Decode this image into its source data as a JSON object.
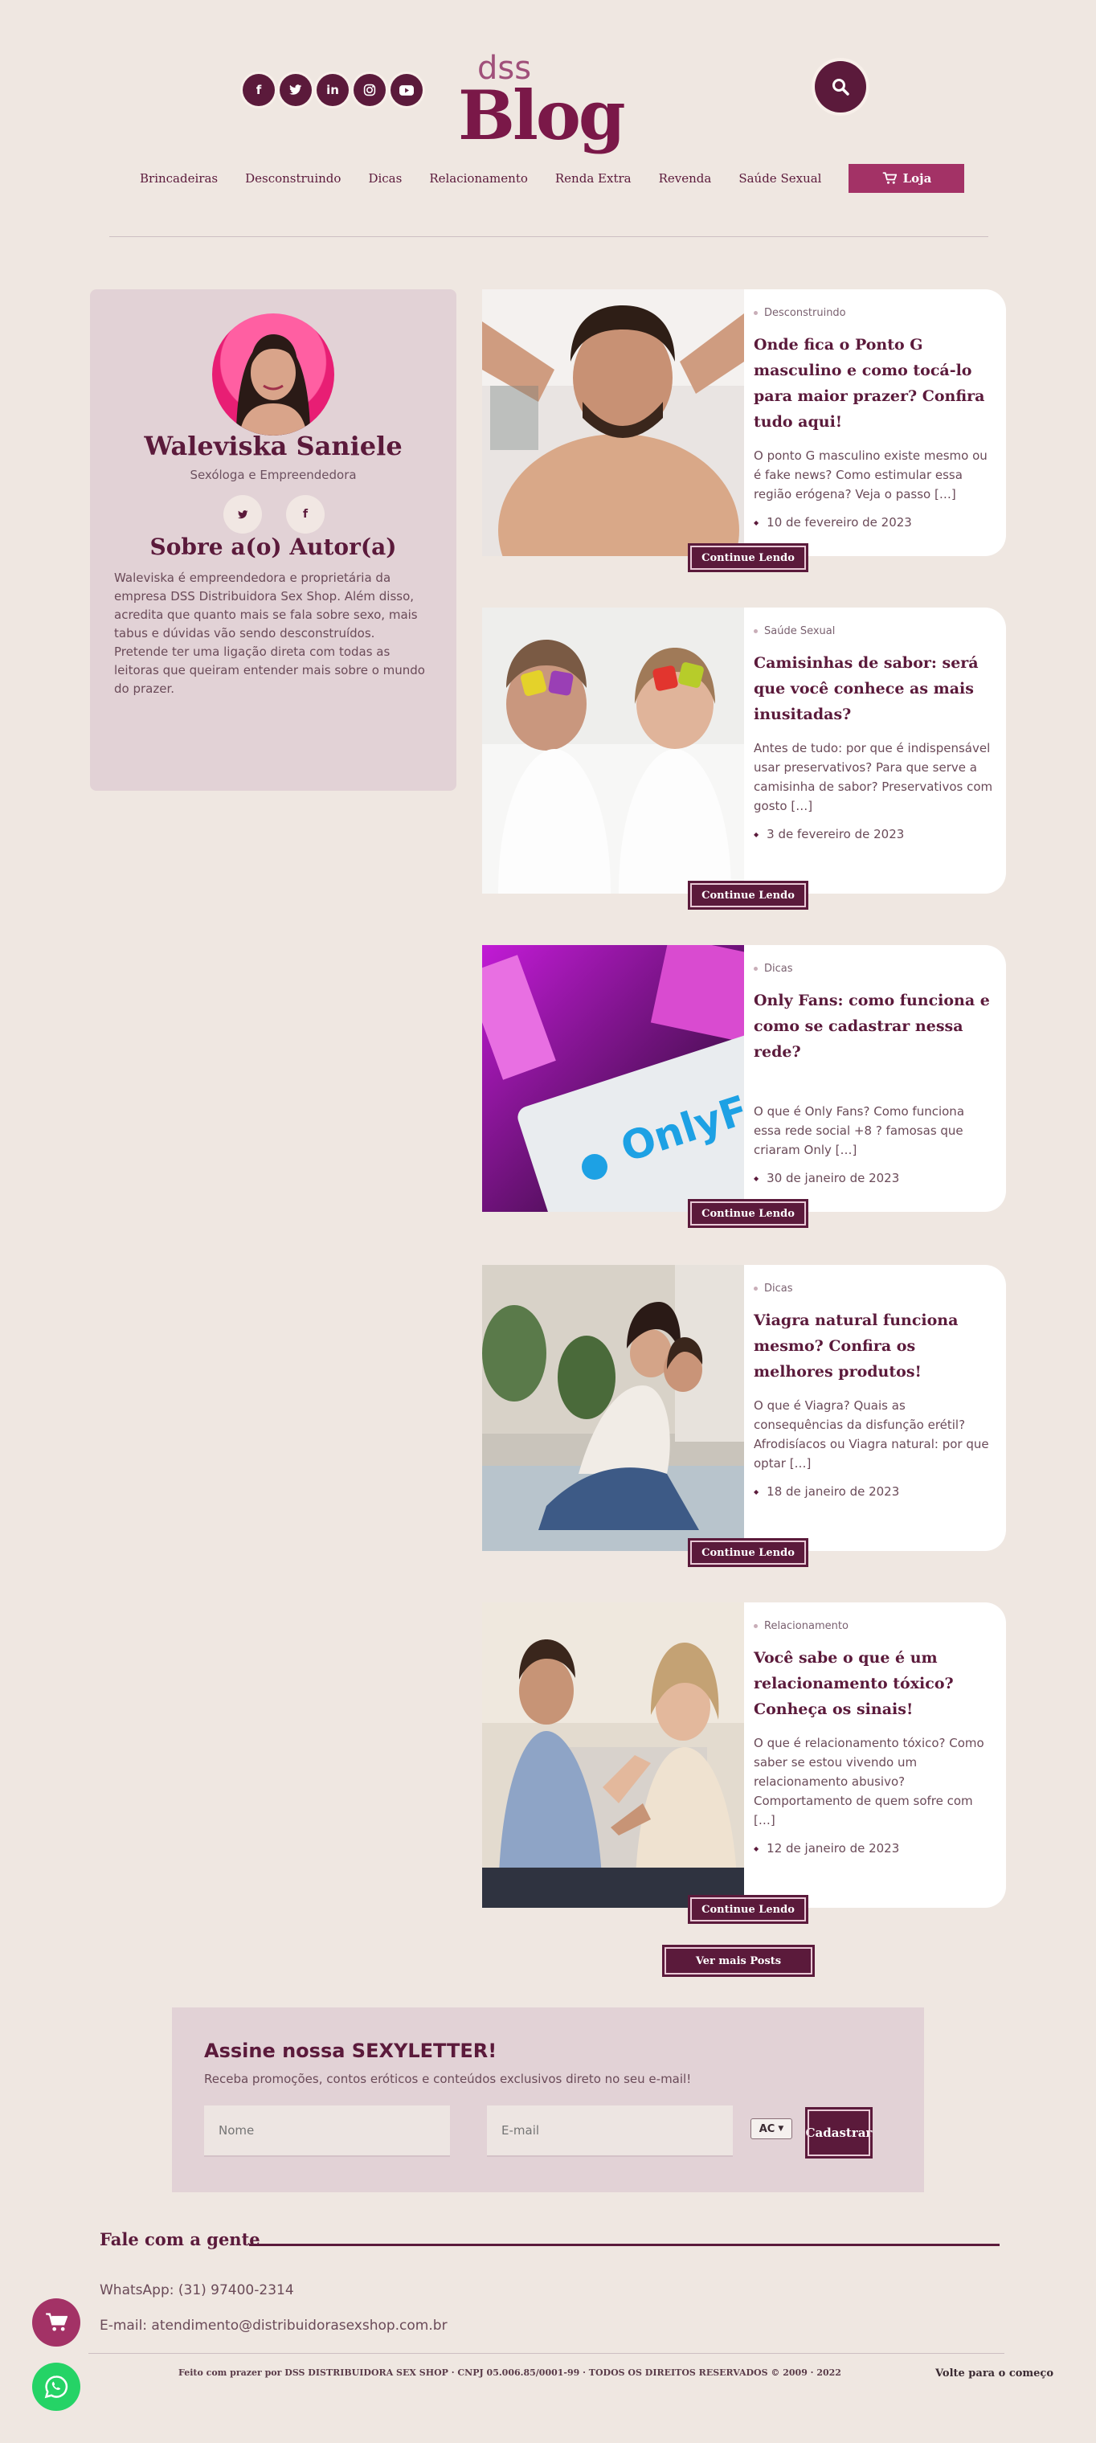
{
  "header": {
    "socials": [
      {
        "icon": "facebook-icon",
        "glyph": "f"
      },
      {
        "icon": "twitter-icon",
        "glyph": "t"
      },
      {
        "icon": "linkedin-icon",
        "glyph": "in"
      },
      {
        "icon": "instagram-icon",
        "glyph": "◎"
      },
      {
        "icon": "youtube-icon",
        "glyph": "▶"
      }
    ],
    "logo_small": "dss",
    "logo_big": "Blog",
    "nav": [
      "Brincadeiras",
      "Desconstruindo",
      "Dicas",
      "Relacionamento",
      "Renda Extra",
      "Revenda",
      "Saúde Sexual"
    ],
    "shop_label": "Loja"
  },
  "author": {
    "name": "Waleviska Saniele",
    "role": "Sexóloga e Empreendedora",
    "about_title": "Sobre a(o) Autor(a)",
    "about_text": "Waleviska é empreendedora e proprietária da empresa DSS Distribuidora Sex Shop. Além disso, acredita que quanto mais se fala sobre sexo, mais tabus e dúvidas vão sendo desconstruídos. Pretende ter uma ligação direta com todas as leitoras que queiram entender mais sobre o mundo do prazer."
  },
  "posts": [
    {
      "category": "Desconstruindo",
      "title": "Onde fica o Ponto G masculino e como tocá-lo para maior prazer? Confira tudo aqui!",
      "excerpt": "O ponto G masculino existe mesmo ou é fake news? Como estimular essa região erógena? Veja o passo […]",
      "date": "10 de fevereiro de 2023",
      "button": "Continue Lendo"
    },
    {
      "category": "Saúde Sexual",
      "title": "Camisinhas de sabor: será que você conhece as mais inusitadas?",
      "excerpt": "Antes de tudo: por que é indispensável usar preservativos? Para que serve a camisinha de sabor? Preservativos com gosto […]",
      "date": "3 de fevereiro de 2023",
      "button": "Continue Lendo"
    },
    {
      "category": "Dicas",
      "title": "Only Fans: como funciona e como se cadastrar nessa rede?",
      "excerpt": "O que é Only Fans? Como funciona essa rede social +8 ? famosas que criaram Only […]",
      "date": "30 de janeiro de 2023",
      "button": "Continue Lendo",
      "image_text": "OnlyFa"
    },
    {
      "category": "Dicas",
      "title": "Viagra natural funciona mesmo? Confira os melhores produtos!",
      "excerpt": "O que é Viagra? Quais as consequências da disfunção erétil? Afrodisíacos ou Viagra natural: por que optar […]",
      "date": "18 de janeiro de 2023",
      "button": "Continue Lendo"
    },
    {
      "category": "Relacionamento",
      "title": "Você sabe o que é um relacionamento tóxico? Conheça os sinais!",
      "excerpt": "O que é relacionamento tóxico? Como saber se estou vivendo um relacionamento abusivo? Comportamento de quem sofre com […]",
      "date": "12 de janeiro de 2023",
      "button": "Continue Lendo"
    }
  ],
  "more_posts": "Ver mais Posts",
  "newsletter": {
    "title": "Assine nossa SEXYLETTER!",
    "subtitle": "Receba promoções, contos eróticos e conteúdos exclusivos direto no seu e-mail!",
    "name_placeholder": "Nome",
    "email_placeholder": "E-mail",
    "state_value": "AC",
    "submit": "Cadastrar"
  },
  "contact": {
    "title": "Fale com a gente",
    "whatsapp": "WhatsApp: (31) 97400-2314",
    "email": "E-mail: atendimento@distribuidorasexshop.com.br"
  },
  "footer": {
    "text": "Feito com prazer por DSS DISTRIBUIDORA SEX SHOP · CNPJ 05.006.85/0001-99 · TODOS OS DIREITOS RESERVADOS © 2009 · 2022",
    "back_to_top": "Volte para o começo"
  },
  "colors": {
    "background": "#efe7e1",
    "brand": "#5b1a3b",
    "accent": "#a33266",
    "card": "#e2d2d6",
    "whatsapp": "#25d366"
  }
}
